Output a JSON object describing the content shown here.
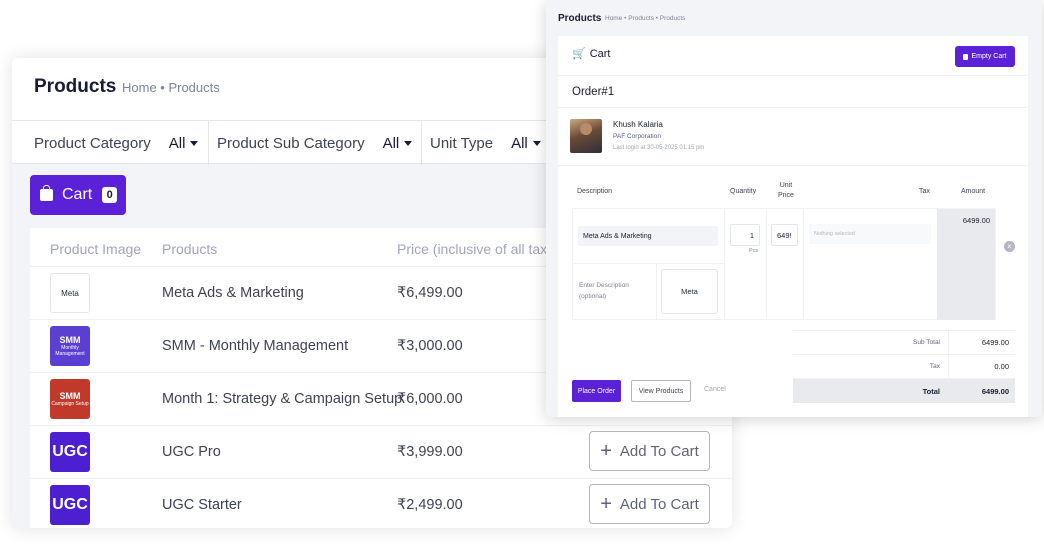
{
  "products_page": {
    "title": "Products",
    "breadcrumb": "Home • Products",
    "filters": [
      {
        "label": "Product Category",
        "value": "All"
      },
      {
        "label": "Product Sub Category",
        "value": "All"
      },
      {
        "label": "Unit Type",
        "value": "All"
      }
    ],
    "cart_button": {
      "label": "Cart",
      "count": "0"
    },
    "table": {
      "headers": [
        "Product Image",
        "Products",
        "Price (inclusive of all tax"
      ],
      "rows": [
        {
          "image_text": "Meta",
          "name": "Meta Ads & Marketing",
          "price": "₹6,499.00"
        },
        {
          "image_text": "SMM",
          "image_subtext": "Monthly Management",
          "name": "SMM - Monthly Management",
          "price": "₹3,000.00"
        },
        {
          "image_text": "SMM",
          "image_subtext": "Campaign Setup",
          "name": "Month 1: Strategy & Campaign Setup",
          "price": "₹6,000.00"
        },
        {
          "image_text": "UGC",
          "name": "UGC Pro",
          "price": "₹3,999.00",
          "action": "Add To Cart"
        },
        {
          "image_text": "UGC",
          "name": "UGC Starter",
          "price": "₹2,499.00",
          "action": "Add To Cart"
        }
      ]
    }
  },
  "cart_page": {
    "title": "Products",
    "breadcrumb": "Home • Products • Products",
    "cart_label": "Cart",
    "empty_button": "Empty Cart",
    "order_title": "Order#1",
    "customer": {
      "name": "Khush Kalaria",
      "company": "PAF Corporation",
      "last_login": "Last login at 30-05-2025 01:15 pm"
    },
    "columns": {
      "description": "Description",
      "quantity": "Quantity",
      "unit_price_1": "Unit",
      "unit_price_2": "Price",
      "tax": "Tax",
      "amount": "Amount"
    },
    "item": {
      "description": "Meta Ads & Marketing",
      "desc_placeholder_1": "Enter Description",
      "desc_placeholder_2": "(optional)",
      "thumb_text": "Meta",
      "quantity": "1",
      "unit": "Pcs",
      "unit_price": "649!",
      "tax_placeholder": "Nothing selected",
      "amount": "6499.00"
    },
    "totals": {
      "sub_total_label": "Sub Total",
      "sub_total": "6499.00",
      "tax_label": "Tax",
      "tax": "0.00",
      "total_label": "Total",
      "total": "6499.00"
    },
    "actions": {
      "place_order": "Place Order",
      "view_products": "View Products",
      "cancel": "Cancel"
    }
  },
  "colors": {
    "primary": "#5b21d6",
    "page_bg": "#f3f4f7"
  }
}
